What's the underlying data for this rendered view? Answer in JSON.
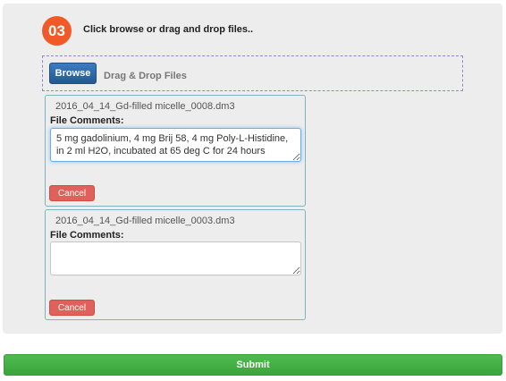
{
  "step": {
    "number": "03",
    "title": "Click browse or drag and drop files.."
  },
  "dropzone": {
    "browse_label": "Browse",
    "drag_drop_label": "Drag & Drop Files"
  },
  "files": [
    {
      "name": "2016_04_14_Gd-filled micelle_0008.dm3",
      "comments_label": "File Comments:",
      "comment_value": "5 mg gadolinium, 4 mg Brij 58, 4 mg Poly-L-Histidine, in 2 ml H2O, incubated at 65 deg C for 24 hours",
      "cancel_label": "Cancel"
    },
    {
      "name": "2016_04_14_Gd-filled micelle_0003.dm3",
      "comments_label": "File Comments:",
      "comment_value": "",
      "cancel_label": "Cancel"
    }
  ],
  "submit_label": "Submit",
  "colors": {
    "step_badge": "#f05a28",
    "browse": "#2d6aa8",
    "cancel": "#e0605b",
    "submit": "#44b044",
    "card_border": "#7fb3bf"
  }
}
